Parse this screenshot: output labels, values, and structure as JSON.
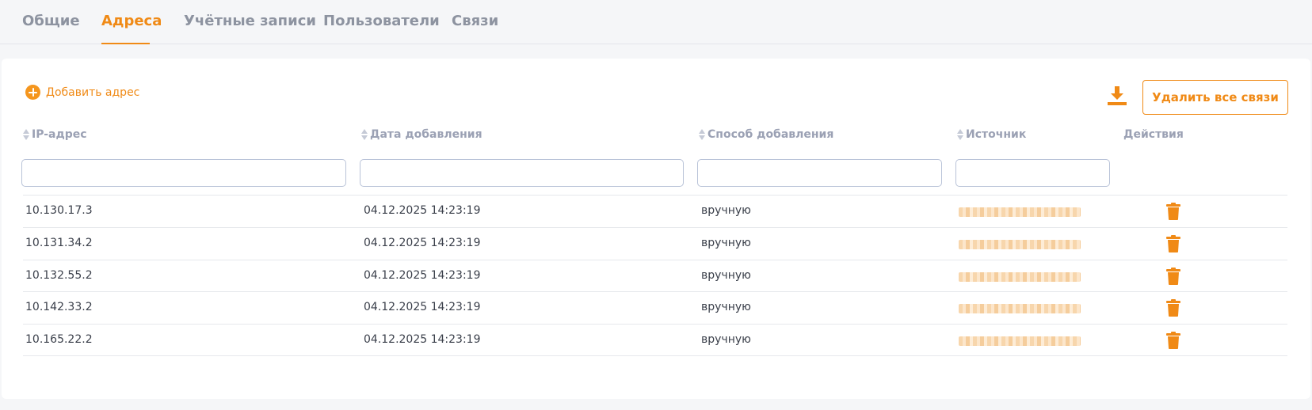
{
  "tabs": [
    {
      "label": "Общие",
      "active": false
    },
    {
      "label": "Адреса",
      "active": true
    },
    {
      "label": "Учётные записи",
      "active": false
    },
    {
      "label": "Пользователи",
      "active": false
    },
    {
      "label": "Связи",
      "active": false
    }
  ],
  "toolbar": {
    "add_label": "Добавить адрес",
    "delete_all_label": "Удалить все связи"
  },
  "columns": {
    "ip": "IP-адрес",
    "date": "Дата добавления",
    "method": "Способ добавления",
    "source": "Источник",
    "actions": "Действия"
  },
  "filters": {
    "ip": "",
    "date": "",
    "method": "",
    "source": ""
  },
  "rows": [
    {
      "ip": "10.130.17.3",
      "date": "04.12.2025 14:23:19",
      "method": "вручную"
    },
    {
      "ip": "10.131.34.2",
      "date": "04.12.2025 14:23:19",
      "method": "вручную"
    },
    {
      "ip": "10.132.55.2",
      "date": "04.12.2025 14:23:19",
      "method": "вручную"
    },
    {
      "ip": "10.142.33.2",
      "date": "04.12.2025 14:23:19",
      "method": "вручную"
    },
    {
      "ip": "10.165.22.2",
      "date": "04.12.2025 14:23:19",
      "method": "вручную"
    }
  ],
  "colors": {
    "accent": "#f08a16",
    "muted": "#8d93a0"
  },
  "icons": {
    "add": "plus-circle-icon",
    "download": "download-icon",
    "sort": "sort-icon",
    "delete": "trash-icon"
  }
}
